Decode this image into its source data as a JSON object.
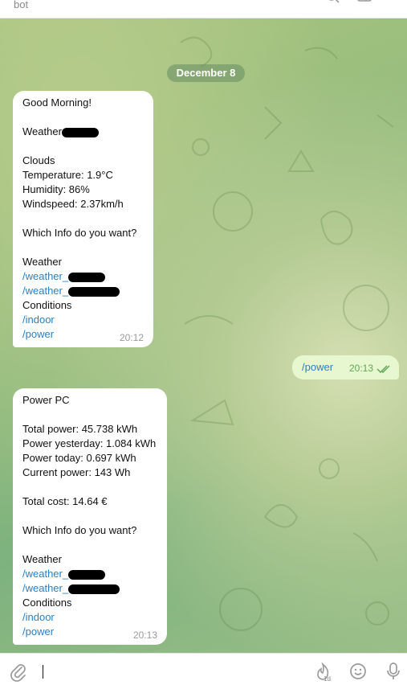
{
  "header": {
    "title": "bot"
  },
  "chat": {
    "date": "December 8",
    "messages": [
      {
        "lines": [
          "Good Morning!",
          "",
          "Weather",
          "",
          "Clouds",
          "Temperature: 1.9°C",
          "Humidity: 86%",
          "Windspeed: 2.37km/h",
          "",
          "Which Info do you want?",
          "",
          "Weather",
          "/weather_",
          "/weather_",
          "Conditions",
          "/indoor",
          "/power"
        ],
        "time": "20:12"
      },
      {
        "text": "/power",
        "time": "20:13"
      },
      {
        "lines": [
          "Power PC",
          "",
          "Total power: 45.738 kWh",
          "Power yesterday: 1.084 kWh",
          "Power today: 0.697 kWh",
          "Current power: 143 Wh",
          "",
          "Total cost: 14.64 €",
          "",
          "Which Info do you want?",
          "",
          "Weather",
          "/weather_",
          "/weather_",
          "Conditions",
          "/indoor",
          "/power"
        ],
        "time": "20:13"
      }
    ]
  },
  "composer": {
    "placeholder": "",
    "timer_badge": "1d"
  },
  "icons": {
    "attach": "paperclip-icon",
    "timer": "flame-timer-icon",
    "emoji": "smile-icon",
    "mic": "microphone-icon",
    "read": "double-check-icon"
  },
  "colors": {
    "link": "#2b7fc2",
    "outgoing_bubble": "#e7f7d0",
    "outgoing_time": "#5fa856"
  }
}
